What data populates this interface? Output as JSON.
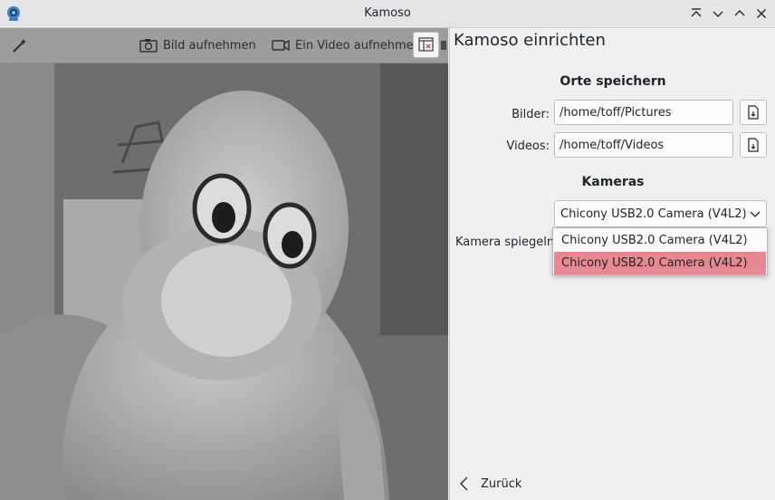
{
  "window": {
    "title": "Kamoso",
    "controls": [
      "keep-above-icon",
      "minimize-icon",
      "maximize-icon",
      "close-icon"
    ]
  },
  "toolbar": {
    "take_picture_label": "Bild aufnehmen",
    "record_video_label": "Ein Video aufnehmen"
  },
  "settings": {
    "title": "Kamoso einrichten",
    "locations_heading": "Orte speichern",
    "pictures_label": "Bilder:",
    "pictures_path": "/home/toff/Pictures",
    "videos_label": "Videos:",
    "videos_path": "/home/toff/Videos",
    "cameras_heading": "Kameras",
    "camera_selected": "Chicony USB2.0 Camera (V4L2)",
    "mirror_label": "Kamera spiegeln",
    "camera_options": [
      "Chicony USB2.0 Camera (V4L2)",
      "Chicony USB2.0 Camera (V4L2)"
    ],
    "back_label": "Zurück"
  },
  "colors": {
    "highlight": "#e58891",
    "toolbar": "#9b9c9d",
    "titlebar": "#e3e5e7"
  }
}
